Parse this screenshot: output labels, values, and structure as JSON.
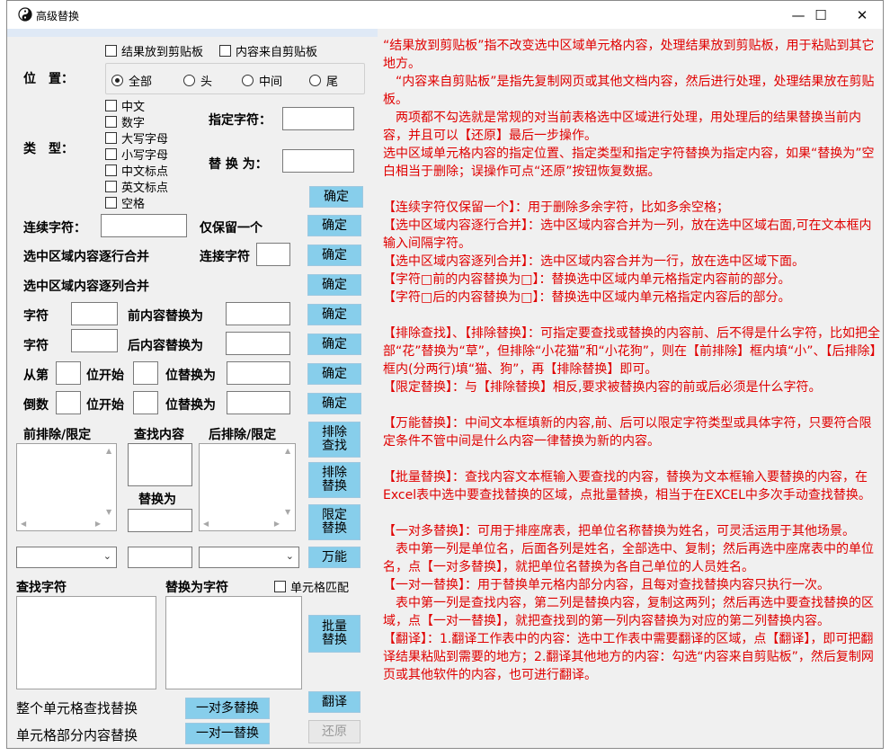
{
  "window": {
    "title": "高级替换",
    "controls": {
      "minimize": "—",
      "maximize": "☐",
      "close": "✕"
    }
  },
  "options": {
    "result_to_clipboard": "结果放到剪贴板",
    "content_from_clipboard": "内容来自剪贴板"
  },
  "position": {
    "label": "位　置：",
    "choices": [
      "全部",
      "头",
      "中间",
      "尾"
    ],
    "selected": "全部"
  },
  "type": {
    "label": "类　型：",
    "checks": [
      "中文",
      "数字",
      "大写字母",
      "小写字母",
      "中文标点",
      "英文标点",
      "空格"
    ],
    "specified_char_label": "指定字符：",
    "replace_with_label": "替 换 为：",
    "confirm": "确定"
  },
  "continuous": {
    "label": "连续字符：",
    "keep_one": "仅保留一个",
    "confirm": "确定"
  },
  "row_merge": {
    "label": "选中区域内容逐行合并",
    "join_label": "连接字符",
    "confirm": "确定"
  },
  "col_merge": {
    "label": "选中区域内容逐列合并",
    "confirm": "确定"
  },
  "before_replace": {
    "char_label": "字符",
    "suffix": "前内容替换为",
    "confirm": "确定"
  },
  "after_replace": {
    "char_label": "字符",
    "suffix": "后内容替换为",
    "confirm": "确定"
  },
  "from_nth": {
    "prefix": "从第",
    "mid": "位开始",
    "suffix": "位替换为",
    "confirm": "确定"
  },
  "from_last": {
    "prefix": "倒数",
    "mid": "位开始",
    "suffix": "位替换为",
    "confirm": "确定"
  },
  "panel": {
    "front_label": "前排除/限定",
    "find_label": "查找内容",
    "back_label": "后排除/限定",
    "replace_label": "替换为",
    "exclude_find": "排除查找",
    "exclude_replace": "排除替换",
    "limit_replace": "限定替换",
    "universal": "万能"
  },
  "batch": {
    "find_label": "查找字符",
    "replace_label": "替换为字符",
    "cell_match": "单元格匹配",
    "batch_replace": "批量替换"
  },
  "bottom": {
    "whole_cell": "整个单元格查找替换",
    "partial_cell": "单元格部分内容替换",
    "one_to_many": "一对多替换",
    "one_to_one": "一对一替换",
    "translate": "翻译",
    "restore": "还原"
  },
  "help": [
    "“结果放到剪贴板”指不改变选中区域单元格内容，处理结果放到剪贴板，用于粘贴到其它地方。",
    "　“内容来自剪贴板”是指先复制网页或其他文档内容，然后进行处理，处理结果放在剪贴板。",
    "　两项都不勾选就是常规的对当前表格选中区域进行处理，用处理后的结果替换当前内容，并且可以【还原】最后一步操作。",
    "选中区域单元格内容的指定位置、指定类型和指定字符替换为指定内容，如果“替换为”空白相当于删除；误操作可点“还原”按钮恢复数据。",
    "",
    "【连续字符仅保留一个】：用于删除多余字符，比如多余空格；",
    "【选中区域内容逐行合并】：选中区域内容合并为一列，放在选中区域右面,可在文本框内输入间隔字符。",
    "【选中区域内容逐列合并】：选中区域内容合并为一行，放在选中区域下面。",
    "【字符□前的内容替换为□】：替换选中区域内单元格指定内容前的部分。",
    "【字符□后的内容替换为□】：替换选中区域内单元格指定内容后的部分。",
    "",
    "【排除查找】、【排除替换】：可指定要查找或替换的内容前、后不得是什么字符，比如把全部“花”替换为“草”，但排除“小花猫”和“小花狗”，则在【前排除】框内填“小”、【后排除】框内(分两行)填“猫、狗”，再【排除替换】即可。",
    "【限定替换】：与【排除替换】相反,要求被替换内容的前或后必须是什么字符。",
    "",
    "【万能替换】：中间文本框填新的内容,前、后可以限定字符类型或具体字符，只要符合限定条件不管中间是什么内容一律替换为新的内容。",
    "",
    "【批量替换】：查找内容文本框输入要查找的内容，替换为文本框输入要替换的内容，在Excel表中选中要查找替换的区域，点批量替换，相当于在EXCEL中多次手动查找替换。",
    "",
    "【一对多替换】：可用于排座席表，把单位名称替换为姓名，可灵活运用于其他场景。",
    "　表中第一列是单位名，后面各列是姓名，全部选中、复制；然后再选中座席表中的单位名，点【一对多替换】，就把单位名替换为各自己单位的人员姓名。",
    "【一对一替换】：用于替换单元格内部分内容，且每对查找替换内容只执行一次。",
    "　表中第一列是查找内容，第二列是替换内容，复制这两列；然后再选中要查找替换的区域，点【一对一替换】，就把查找到的第一列内容替换为对应的第二列替换内容。",
    "【翻译】：1.翻译工作表中的内容：选中工作表中需要翻译的区域，点【翻译】，即可把翻译结果粘贴到需要的地方；2.翻译其他地方的内容：勾选“内容来自剪贴板”，然后复制网页或其他软件的内容，也可进行翻译。"
  ]
}
